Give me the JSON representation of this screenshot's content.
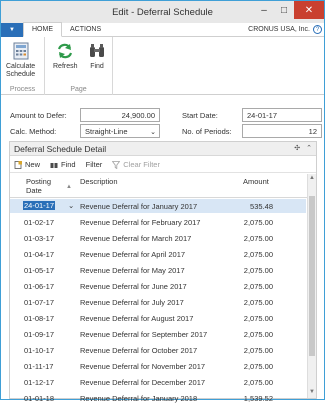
{
  "window": {
    "title": "Edit - Deferral Schedule",
    "minimize": "–",
    "maximize": "□",
    "close": "✕"
  },
  "ribbon": {
    "tabs": [
      {
        "label": "HOME"
      },
      {
        "label": "ACTIONS"
      }
    ],
    "company": "CRONUS USA, Inc.",
    "groups": [
      {
        "label": "Process",
        "buttons": [
          {
            "label_line1": "Calculate",
            "label_line2": "Schedule"
          }
        ]
      },
      {
        "label": "Page",
        "buttons": [
          {
            "label": "Refresh"
          },
          {
            "label": "Find"
          }
        ]
      }
    ]
  },
  "form": {
    "amount_label": "Amount to Defer:",
    "amount_value": "24,900.00",
    "calc_label": "Calc. Method:",
    "calc_value": "Straight-Line",
    "start_label": "Start Date:",
    "start_value": "24-01-17",
    "periods_label": "No. of Periods:",
    "periods_value": "12"
  },
  "subpage": {
    "title": "Deferral Schedule Detail",
    "toolbar": {
      "new": "New",
      "find": "Find",
      "filter": "Filter",
      "clear_filter": "Clear Filter"
    },
    "columns": {
      "posting_line1": "Posting",
      "posting_line2": "Date",
      "description": "Description",
      "amount": "Amount"
    },
    "rows": [
      {
        "date": "24-01-17",
        "description": "Revenue Deferral for January 2017",
        "amount": "535.48"
      },
      {
        "date": "01-02-17",
        "description": "Revenue Deferral for February 2017",
        "amount": "2,075.00"
      },
      {
        "date": "01-03-17",
        "description": "Revenue Deferral for March 2017",
        "amount": "2,075.00"
      },
      {
        "date": "01-04-17",
        "description": "Revenue Deferral for April 2017",
        "amount": "2,075.00"
      },
      {
        "date": "01-05-17",
        "description": "Revenue Deferral for May 2017",
        "amount": "2,075.00"
      },
      {
        "date": "01-06-17",
        "description": "Revenue Deferral for June 2017",
        "amount": "2,075.00"
      },
      {
        "date": "01-07-17",
        "description": "Revenue Deferral for July 2017",
        "amount": "2,075.00"
      },
      {
        "date": "01-08-17",
        "description": "Revenue Deferral for August 2017",
        "amount": "2,075.00"
      },
      {
        "date": "01-09-17",
        "description": "Revenue Deferral for September 2017",
        "amount": "2,075.00"
      },
      {
        "date": "01-10-17",
        "description": "Revenue Deferral for October 2017",
        "amount": "2,075.00"
      },
      {
        "date": "01-11-17",
        "description": "Revenue Deferral for November 2017",
        "amount": "2,075.00"
      },
      {
        "date": "01-12-17",
        "description": "Revenue Deferral for December 2017",
        "amount": "2,075.00"
      },
      {
        "date": "01-01-18",
        "description": "Revenue Deferral for January 2018",
        "amount": "1,539.52"
      }
    ]
  },
  "colors": {
    "accent": "#2a6fb8",
    "close": "#c9402f",
    "selection": "#d8e6f5"
  }
}
